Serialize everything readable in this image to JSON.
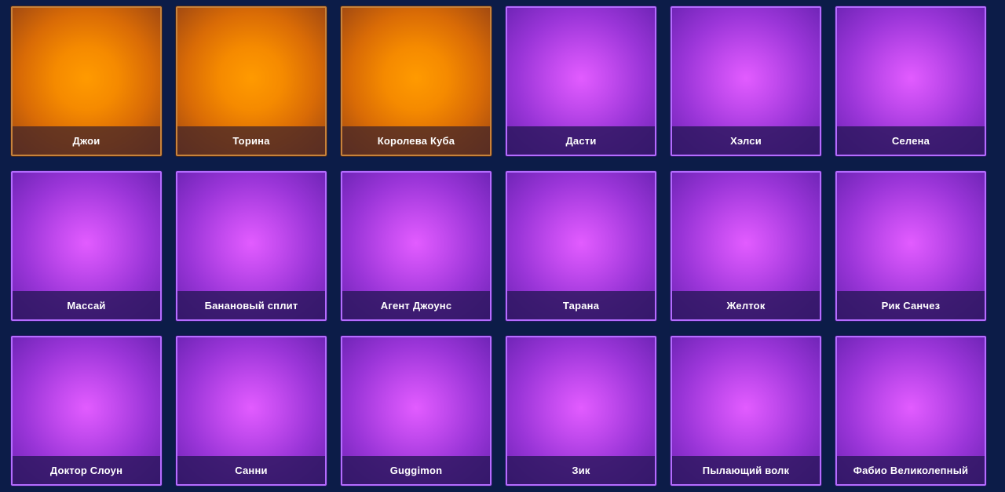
{
  "cards": [
    {
      "name": "Джои",
      "rarity": "legendary"
    },
    {
      "name": "Торина",
      "rarity": "legendary"
    },
    {
      "name": "Королева Куба",
      "rarity": "legendary"
    },
    {
      "name": "Дасти",
      "rarity": "epic"
    },
    {
      "name": "Хэлси",
      "rarity": "epic"
    },
    {
      "name": "Селена",
      "rarity": "epic"
    },
    {
      "name": "Массай",
      "rarity": "epic"
    },
    {
      "name": "Банановый сплит",
      "rarity": "epic"
    },
    {
      "name": "Агент Джоунс",
      "rarity": "epic"
    },
    {
      "name": "Тарана",
      "rarity": "epic"
    },
    {
      "name": "Желток",
      "rarity": "epic"
    },
    {
      "name": "Рик Санчез",
      "rarity": "epic"
    },
    {
      "name": "Доктор Слоун",
      "rarity": "epic"
    },
    {
      "name": "Санни",
      "rarity": "epic"
    },
    {
      "name": "Guggimon",
      "rarity": "epic"
    },
    {
      "name": "Зик",
      "rarity": "epic"
    },
    {
      "name": "Пылающий волк",
      "rarity": "epic"
    },
    {
      "name": "Фабио Великолепный",
      "rarity": "epic"
    }
  ],
  "colors": {
    "background": "#0c1c48",
    "epic_border": "#b46cff",
    "epic_center": "#e25cff",
    "legendary_border": "#c8823a",
    "legendary_center": "#ff9a00"
  }
}
